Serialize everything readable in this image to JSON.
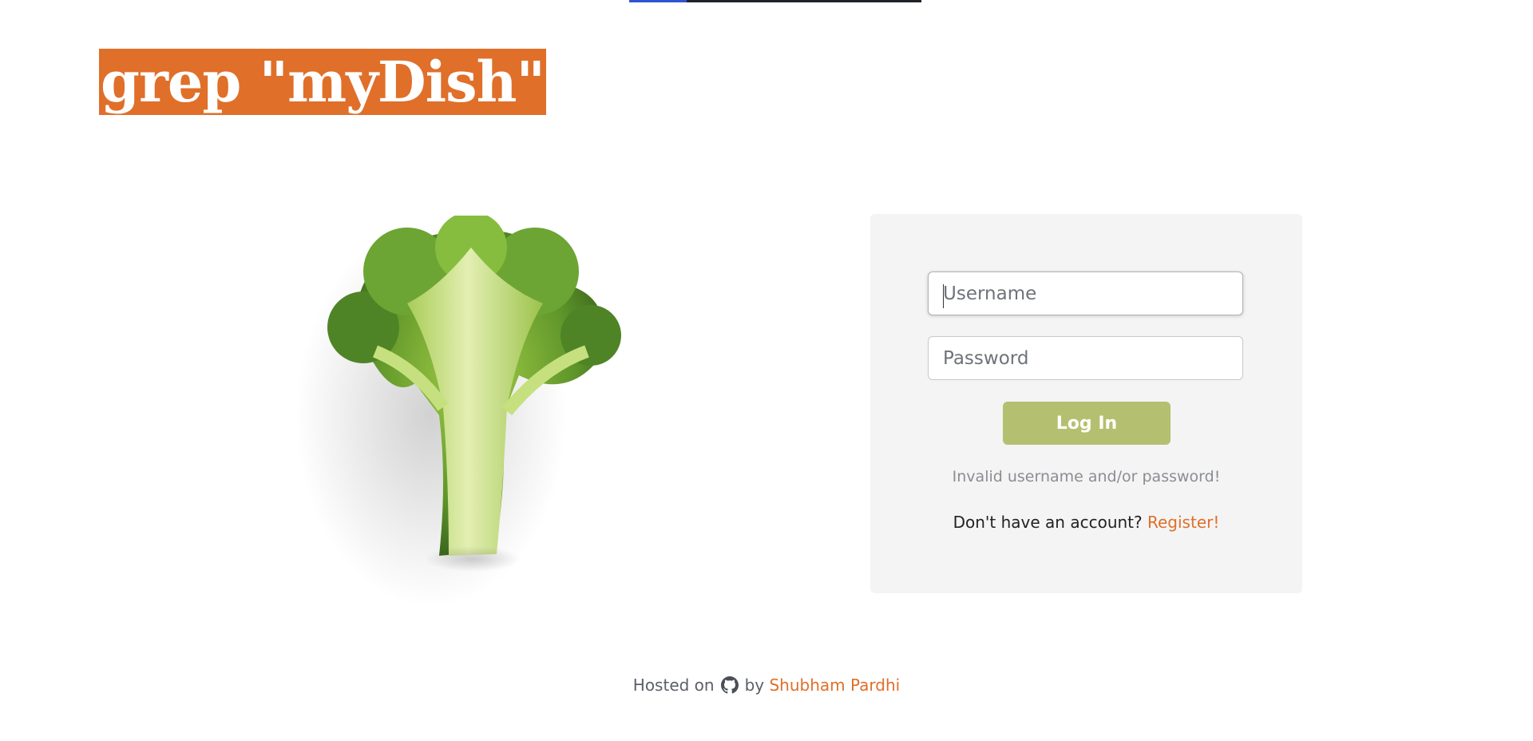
{
  "header": {
    "logo_text": "grep \"myDish\""
  },
  "hero": {
    "icon": "broccoli-icon"
  },
  "login": {
    "username_placeholder": "Username",
    "username_value": "",
    "password_placeholder": "Password",
    "password_value": "",
    "login_label": "Log In",
    "error_text": "Invalid username and/or password!",
    "no_account_text": "Don't have an account?",
    "register_label": "Register!"
  },
  "footer": {
    "hosted_text": "Hosted on",
    "icon": "github-icon",
    "by_text": "by",
    "author": "Shubham Pardhi"
  },
  "colors": {
    "brand": "#e06f2a",
    "button": "#b4c06f",
    "card_bg": "#f4f4f4",
    "broccoli": "#7db23a"
  }
}
